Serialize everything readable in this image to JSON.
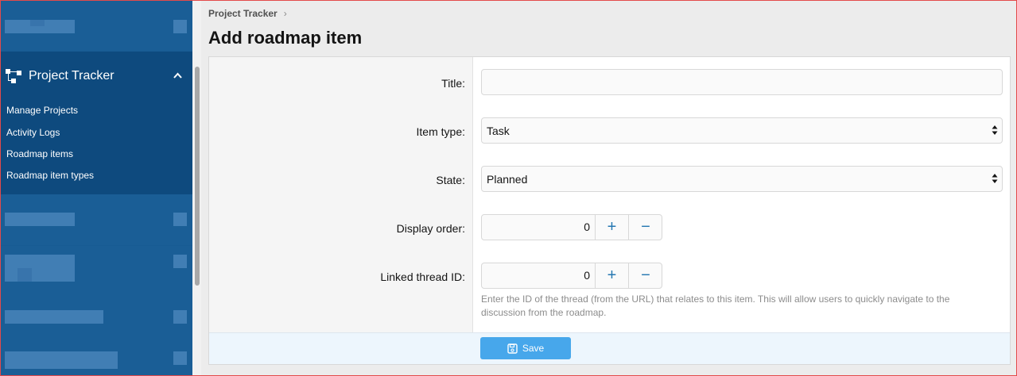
{
  "breadcrumb": {
    "root": "Project Tracker",
    "separator": "›"
  },
  "page": {
    "title": "Add roadmap item"
  },
  "sidebar": {
    "section_title": "Project Tracker",
    "items": [
      {
        "label": "Manage Projects"
      },
      {
        "label": "Activity Logs"
      },
      {
        "label": "Roadmap items"
      },
      {
        "label": "Roadmap item types"
      }
    ]
  },
  "form": {
    "title": {
      "label": "Title:",
      "value": ""
    },
    "item_type": {
      "label": "Item type:",
      "value": "Task"
    },
    "state": {
      "label": "State:",
      "value": "Planned"
    },
    "display_order": {
      "label": "Display order:",
      "value": "0"
    },
    "linked_thread": {
      "label": "Linked thread ID:",
      "value": "0",
      "hint": "Enter the ID of the thread (from the URL) that relates to this item. This will allow users to quickly navigate to the discussion from the roadmap."
    },
    "stepper": {
      "plus": "+",
      "minus": "−"
    },
    "save_label": "Save"
  },
  "colors": {
    "sidebar_bg": "#185b93",
    "sidebar_section_bg": "#0e4a7e",
    "accent": "#47a7eb",
    "link": "#2577b1"
  },
  "icons": {
    "section": "tree-structure-icon",
    "collapse": "chevron-up-icon",
    "save": "save-disk-icon",
    "select": "select-arrows-icon"
  }
}
